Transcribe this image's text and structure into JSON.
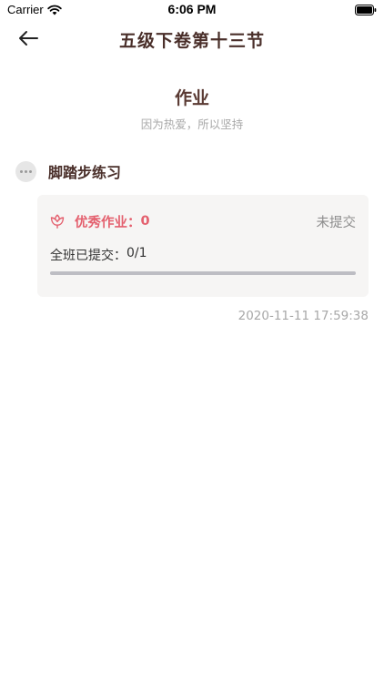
{
  "status_bar": {
    "carrier": "Carrier",
    "time": "6:06 PM"
  },
  "nav": {
    "title": "五级下卷第十三节",
    "back_icon": "arrow-left-icon"
  },
  "header": {
    "title": "作业",
    "subtitle": "因为热爱，所以坚持"
  },
  "item": {
    "title": "脚踏步练习",
    "icon": "more-dots-icon"
  },
  "card": {
    "excellent_label": "优秀作业：",
    "excellent_count": "0",
    "status": "未提交",
    "submitted_label": "全班已提交：",
    "submitted_value": "0/1",
    "progress_fraction": 0,
    "accent_color": "#e4606e"
  },
  "timestamp": "2020-11-11 17:59:38"
}
